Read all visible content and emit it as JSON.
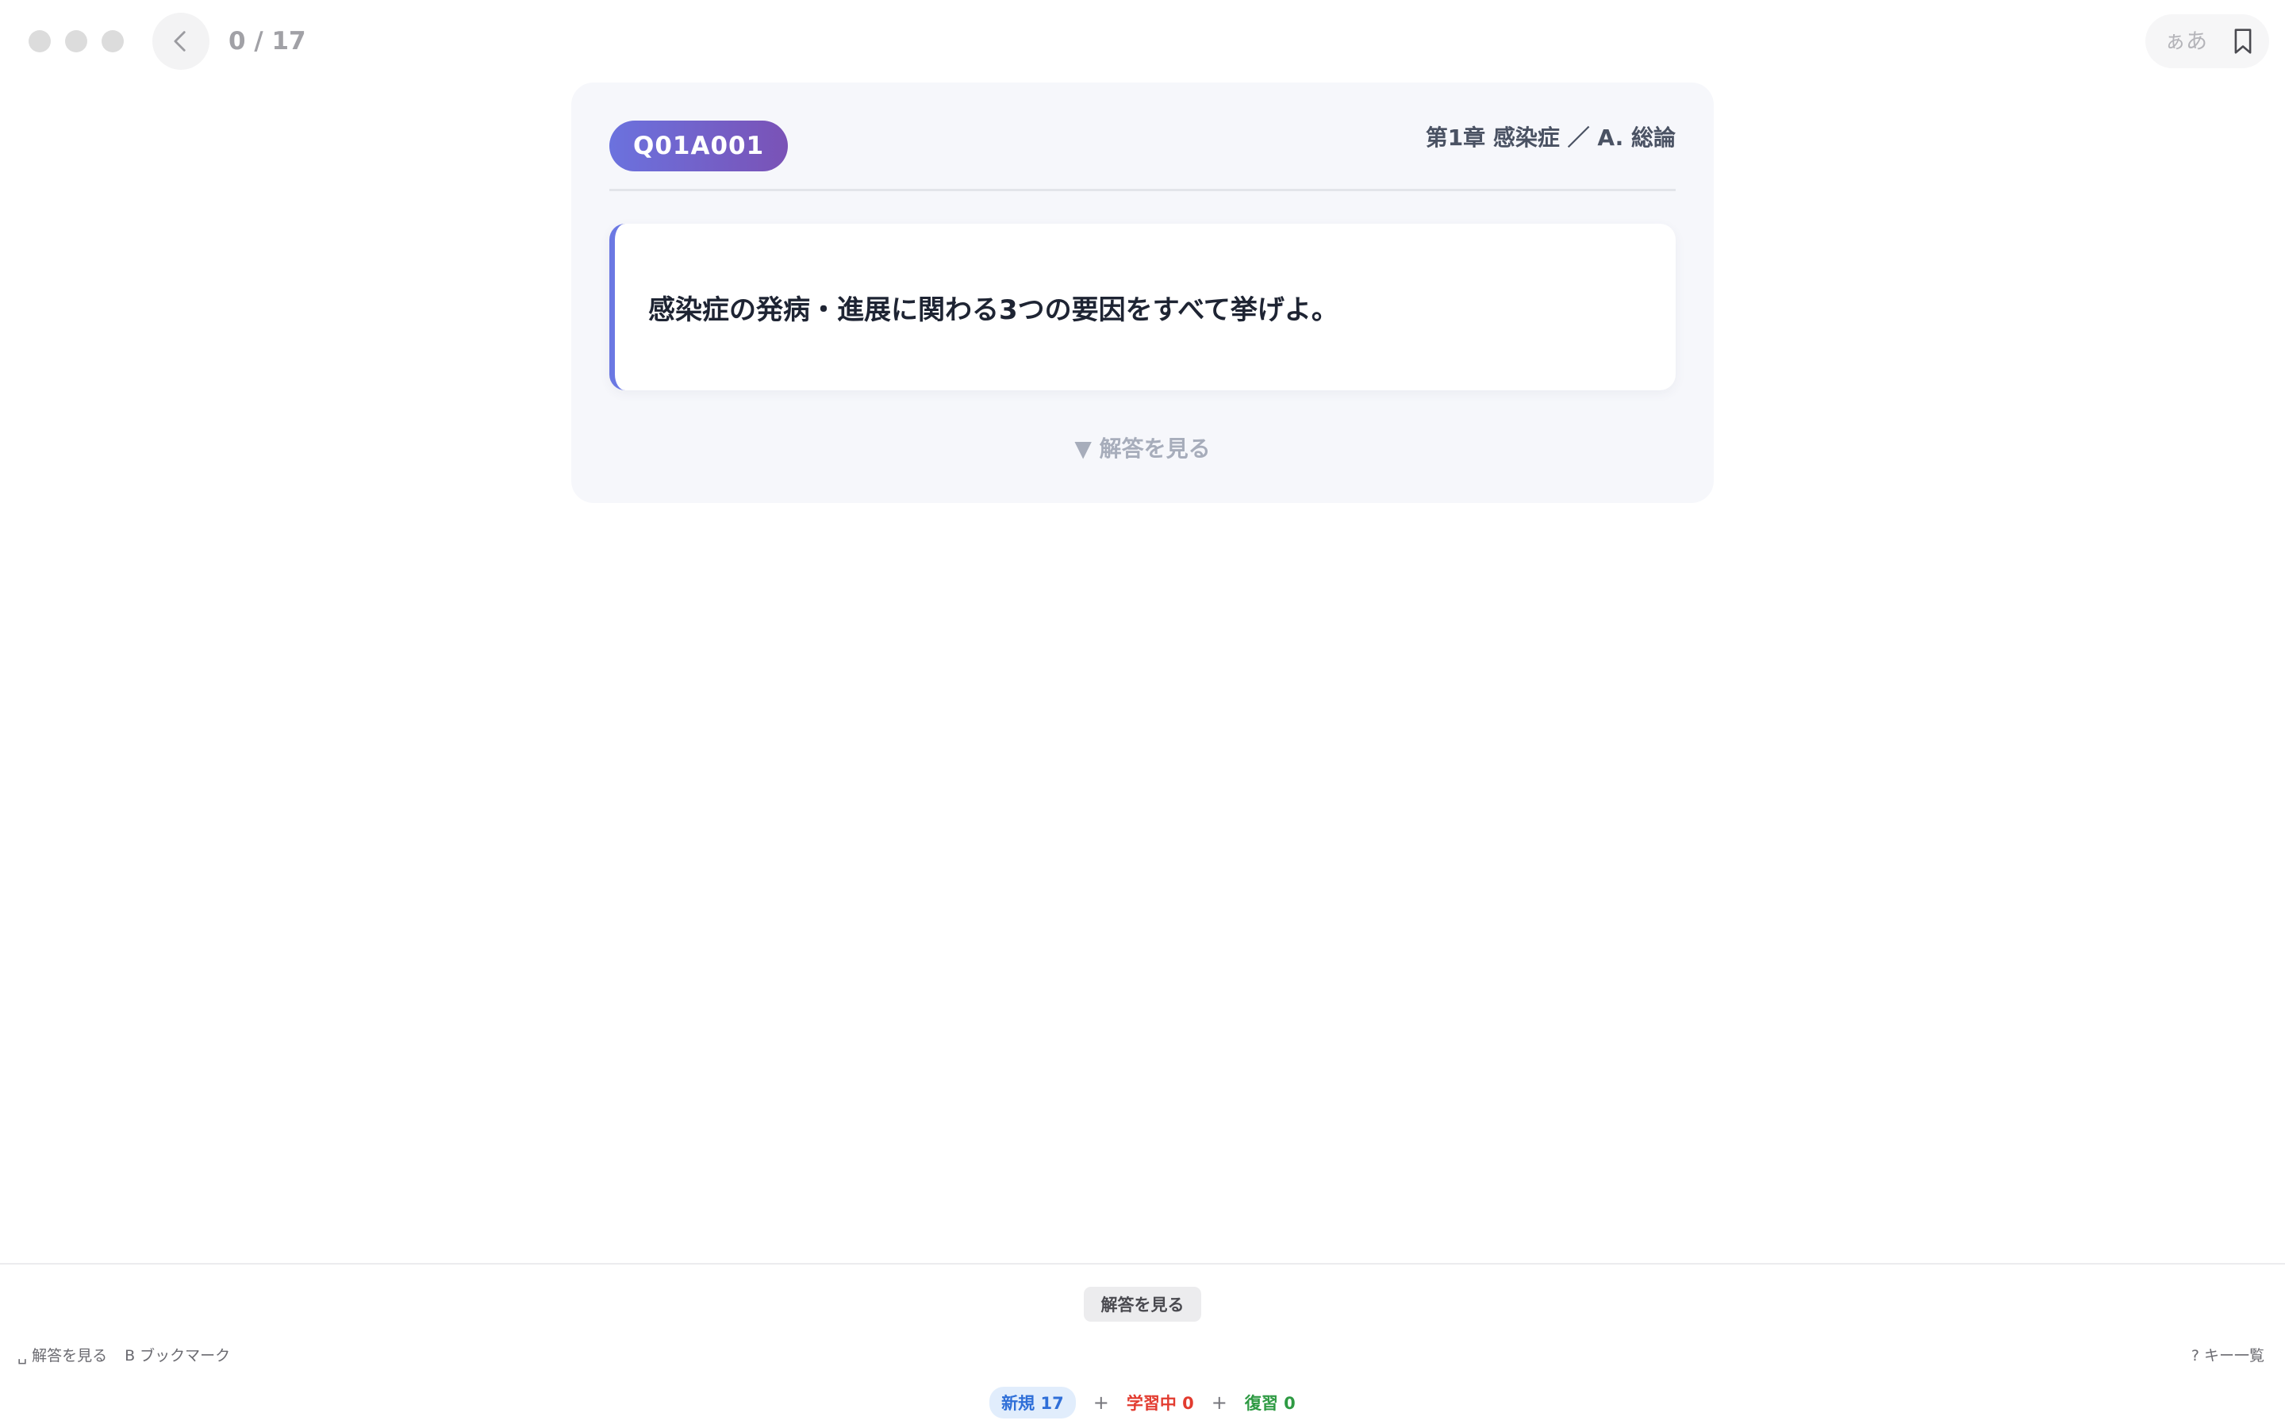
{
  "window": {
    "counter": "0 / 17",
    "font_toggle_label": "ぁあ"
  },
  "card": {
    "question_id": "Q01A001",
    "breadcrumb": "第1章 感染症 ／ A. 総論",
    "question": "感染症の発病・進展に関わる3つの要因をすべて挙げよ。",
    "reveal_label": "▼ 解答を見る"
  },
  "footer": {
    "show_answer_button": "解答を見る",
    "shortcuts": [
      "␣ 解答を見る",
      "B ブックマーク"
    ],
    "key_help": "? キー一覧",
    "stats": {
      "new": "新規 17",
      "learning": "学習中 0",
      "review": "復習 0",
      "plus": "+"
    }
  },
  "colors": {
    "accent_gradient_start": "#6b72de",
    "accent_gradient_end": "#7a52b6",
    "new_color": "#2f6fd8",
    "learning_color": "#e23b2f",
    "review_color": "#2e9a43"
  },
  "icons": {
    "back": "chevron-left-icon",
    "bookmark": "bookmark-icon"
  }
}
